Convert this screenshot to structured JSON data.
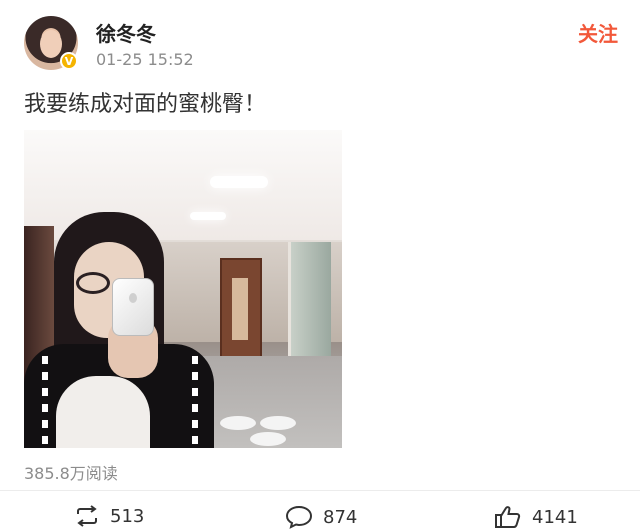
{
  "post": {
    "username": "徐冬冬",
    "timestamp": "01-25 15:52",
    "follow_label": "关注",
    "text": "我要练成对面的蜜桃臀！",
    "reads": "385.8万阅读",
    "verified_badge": "V"
  },
  "actions": {
    "repost_count": "513",
    "comment_count": "874",
    "like_count": "4141"
  },
  "colors": {
    "accent": "#f2583a",
    "verified": "#f5b400",
    "muted": "#8c8c8c"
  },
  "icons": [
    "repost-icon",
    "comment-icon",
    "like-icon"
  ]
}
